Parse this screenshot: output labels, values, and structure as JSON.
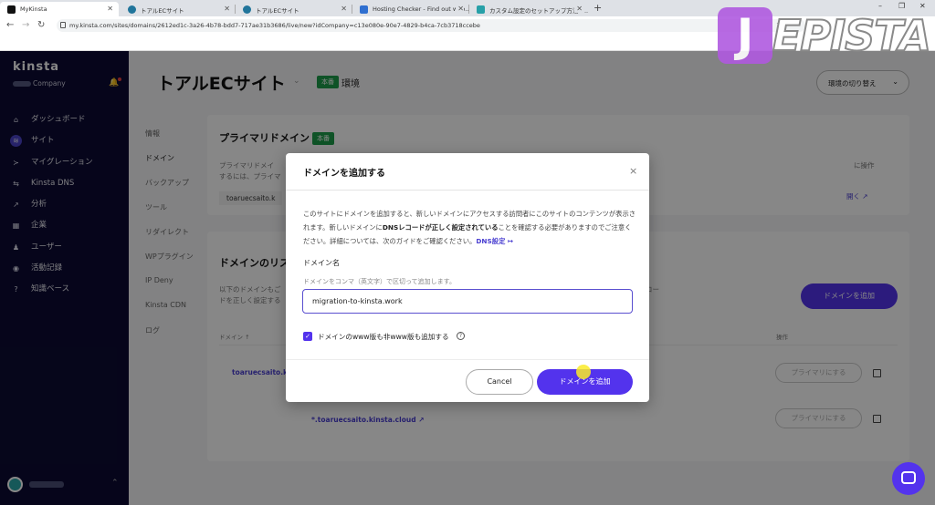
{
  "browser": {
    "tabs": [
      {
        "title": "MyKinsta",
        "active": true
      },
      {
        "title": "トアルECサイト",
        "active": false
      },
      {
        "title": "トアルECサイト",
        "active": false
      },
      {
        "title": "Hosting Checker - Find out who...",
        "active": false
      },
      {
        "title": "カスタム設定のセットアップ方法 - ...",
        "active": false
      }
    ],
    "new_tab": "+",
    "url": "my.kinsta.com/sites/domains/2612ed1c-3a26-4b78-bdd7-717ae31b3686/live/new?idCompany=c13e080e-90e7-4829-b4ca-7cb3718ccebe",
    "window_controls": [
      "–",
      "❐",
      "✕"
    ]
  },
  "watermark": {
    "initial": "J",
    "rest": "EPISTA"
  },
  "sidebar": {
    "logo": "kinsta",
    "company": "Company",
    "items": [
      {
        "label": "ダッシュボード",
        "icon": "home-icon",
        "glyph": "⌂"
      },
      {
        "label": "サイト",
        "icon": "sites-icon",
        "glyph": "≋",
        "active": true
      },
      {
        "label": "マイグレーション",
        "icon": "migration-icon",
        "glyph": "≻"
      },
      {
        "label": "Kinsta DNS",
        "icon": "dns-icon",
        "glyph": "⇆"
      },
      {
        "label": "分析",
        "icon": "analytics-icon",
        "glyph": "↗"
      },
      {
        "label": "企業",
        "icon": "company-icon",
        "glyph": "▦"
      },
      {
        "label": "ユーザー",
        "icon": "user-add-icon",
        "glyph": "♟"
      },
      {
        "label": "活動記録",
        "icon": "eye-icon",
        "glyph": "◉"
      },
      {
        "label": "知識ベース",
        "icon": "help-icon",
        "glyph": "?"
      }
    ]
  },
  "main": {
    "site_title": "トアルECサイト",
    "env_badge": "本番",
    "env_label": "環境",
    "env_switch": "環境の切り替え",
    "subnav": [
      "情報",
      "ドメイン",
      "バックアップ",
      "ツール",
      "リダイレクト",
      "WPプラグイン",
      "IP Deny",
      "Kinsta CDN",
      "ログ"
    ],
    "primary": {
      "title": "プライマリドメイン",
      "badge": "本番",
      "desc1": "プライマリドメイ",
      "desc2": "するには、プライマ",
      "desc_right": "に操作",
      "domain": "toaruecsaito.k",
      "open_link": "開く"
    },
    "list": {
      "title": "ドメインのリス",
      "desc1": "以下のドメインもご",
      "desc2": "ドを正しく設定する",
      "desc_right": "コー",
      "add_button": "ドメインを追加",
      "col_domain": "ドメイン ↑",
      "col_action": "操作",
      "rows": [
        {
          "domain": "toaruecsaito.kin",
          "action": "プライマリにする"
        },
        {
          "domain": "*.toaruecsaito.kinsta.cloud",
          "action": "プライマリにする"
        }
      ]
    }
  },
  "modal": {
    "title": "ドメインを追加する",
    "desc_a": "このサイトにドメインを追加すると、新しいドメインにアクセスする訪問者にこのサイトのコンテンツが表示されます。新しいドメインに",
    "desc_bold": "DNSレコードが正しく設定されている",
    "desc_b": "ことを確認する必要がありますのでご注意ください。詳細については、次のガイドをご確認ください。",
    "desc_link": "DNS設定",
    "field_label": "ドメイン名",
    "field_help": "ドメインをコンマ（英文字）で区切って追加します。",
    "field_value": "migration-to-kinsta.work",
    "checkbox_label": "ドメインのwww版も非www版も追加する",
    "cancel": "Cancel",
    "submit": "ドメインを追加"
  }
}
